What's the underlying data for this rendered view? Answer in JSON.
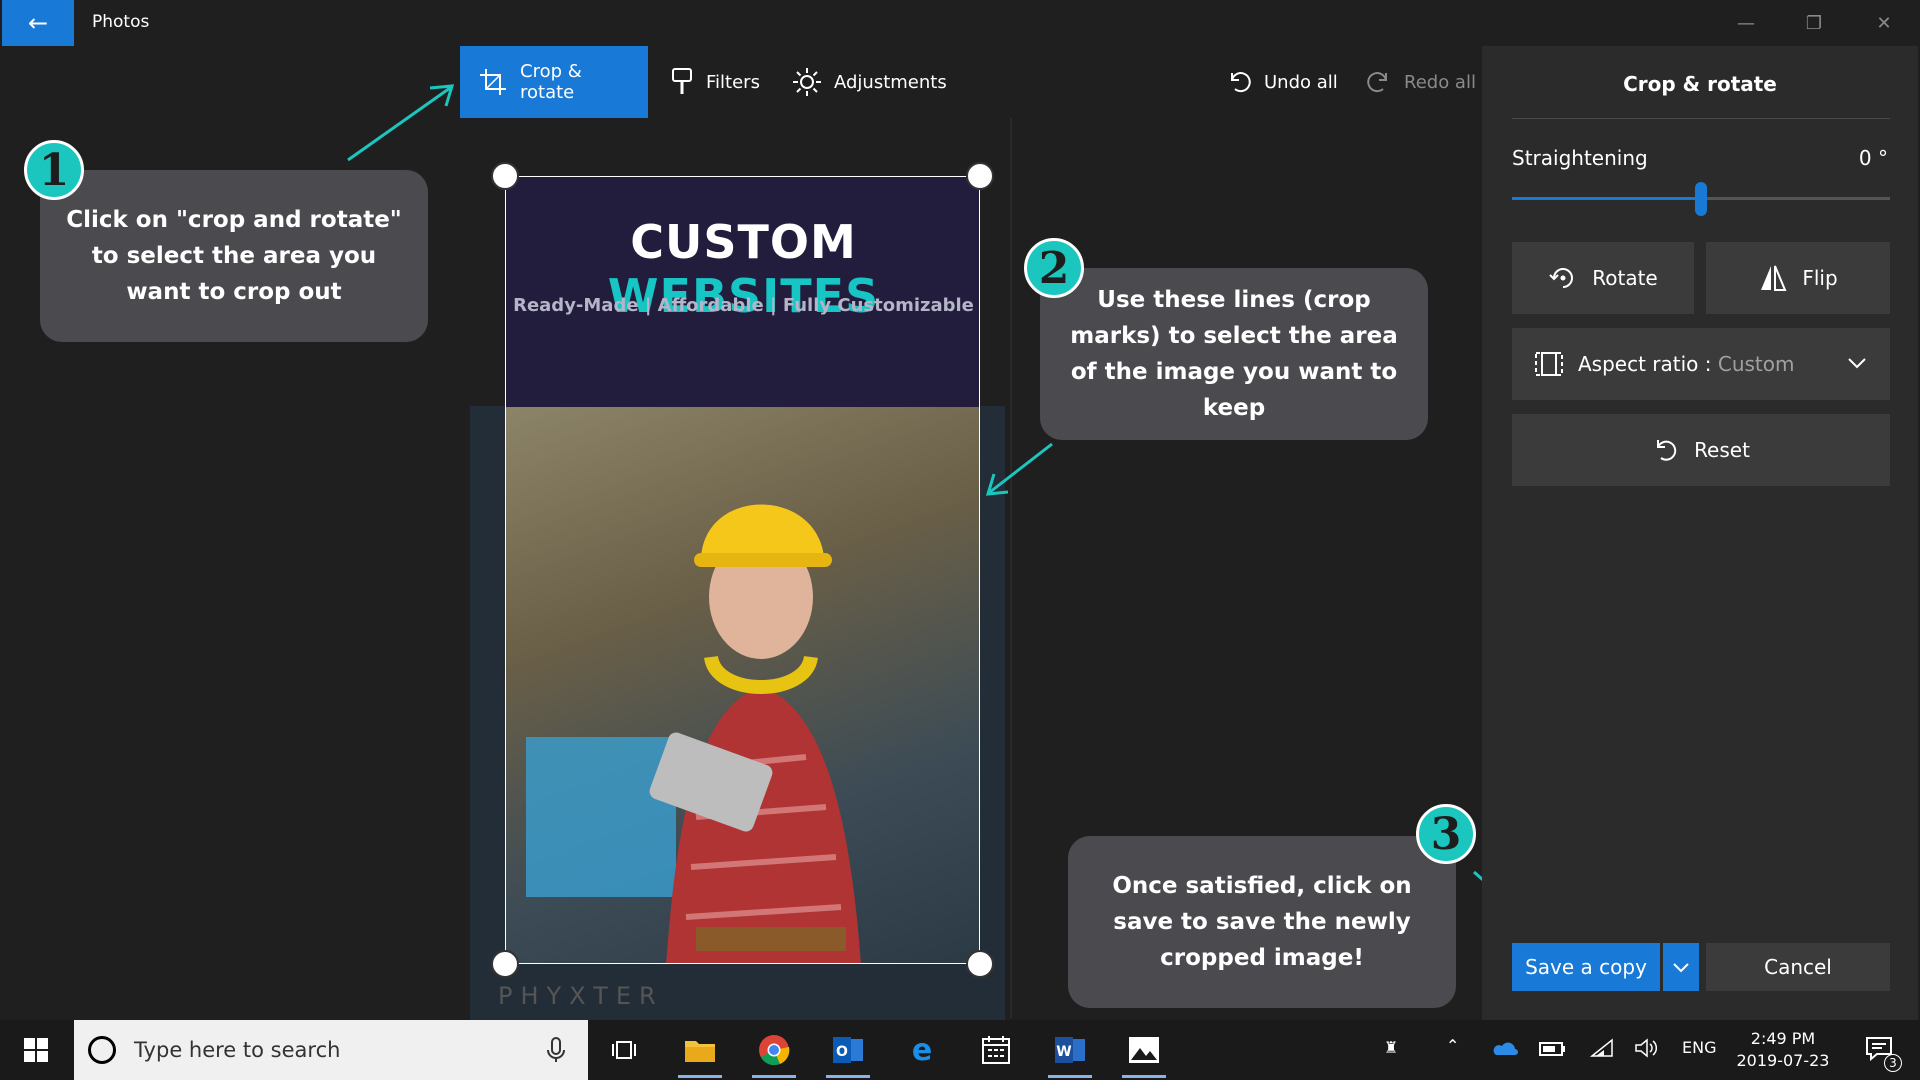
{
  "titlebar": {
    "back_icon": "back-arrow-icon",
    "app_title": "Photos",
    "window_controls": [
      "minimize-icon",
      "restore-icon",
      "close-icon"
    ]
  },
  "toolbar": {
    "crop_rotate": "Crop & rotate",
    "filters": "Filters",
    "adjustments": "Adjustments",
    "undo_all": "Undo all",
    "redo_all": "Redo all"
  },
  "panel": {
    "title": "Crop & rotate",
    "straightening_label": "Straightening",
    "straightening_value": "0 °",
    "straightening_level": 0.5,
    "rotate": "Rotate",
    "flip": "Flip",
    "aspect_label": "Aspect ratio : ",
    "aspect_value": "Custom",
    "reset": "Reset",
    "save_copy": "Save a copy",
    "cancel": "Cancel"
  },
  "image": {
    "title_part1": "CUSTOM ",
    "title_part2": "WEBSITES",
    "subtitle": "Ready-Made | Affordable | Fully Customizable",
    "watermark": "PHYXTER"
  },
  "callouts": [
    {
      "number": "1",
      "text": "Click on \"crop and rotate\" to select the area you want to crop out"
    },
    {
      "number": "2",
      "text": "Use these lines (crop marks) to select the area of the image you want to keep"
    },
    {
      "number": "3",
      "text": "Once satisfied, click on save to save the newly cropped image!"
    }
  ],
  "taskbar": {
    "search_placeholder": "Type here to search",
    "language": "ENG",
    "time": "2:49 PM",
    "date": "2019-07-23",
    "notification_count": "3"
  },
  "colors": {
    "accent": "#1979d6",
    "callout_badge": "#1bc6bf",
    "callout_bg": "#4a4a4f",
    "brand_teal": "#17c5c5"
  }
}
